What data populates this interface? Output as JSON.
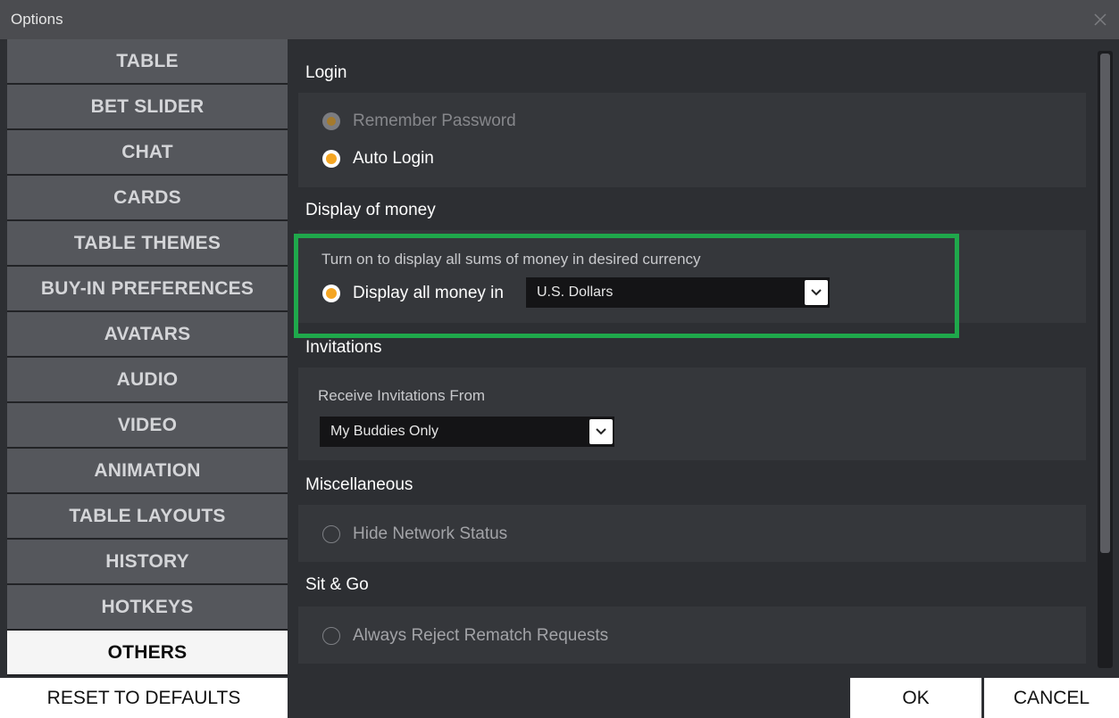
{
  "window": {
    "title": "Options",
    "close_icon": "close-icon"
  },
  "sidebar": {
    "items": [
      {
        "label": "TABLE"
      },
      {
        "label": "BET SLIDER"
      },
      {
        "label": "CHAT"
      },
      {
        "label": "CARDS"
      },
      {
        "label": "TABLE THEMES"
      },
      {
        "label": "BUY-IN PREFERENCES"
      },
      {
        "label": "AVATARS"
      },
      {
        "label": "AUDIO"
      },
      {
        "label": "VIDEO"
      },
      {
        "label": "ANIMATION"
      },
      {
        "label": "TABLE LAYOUTS"
      },
      {
        "label": "HISTORY"
      },
      {
        "label": "HOTKEYS"
      },
      {
        "label": "OTHERS",
        "active": true
      }
    ],
    "reset_label": "RESET TO DEFAULTS"
  },
  "login": {
    "title": "Login",
    "remember_password": "Remember Password",
    "auto_login": "Auto Login"
  },
  "display_money": {
    "title": "Display of money",
    "hint": "Turn on to display all sums of money in desired currency",
    "option_label": "Display all money in",
    "currency_value": "U.S. Dollars"
  },
  "invitations": {
    "title": "Invitations",
    "hint": "Receive Invitations From",
    "selected": "My Buddies Only"
  },
  "misc": {
    "title": "Miscellaneous",
    "hide_network_status": "Hide Network Status"
  },
  "sitgo": {
    "title": "Sit & Go",
    "reject_rematch": "Always Reject Rematch Requests"
  },
  "footer": {
    "ok_label": "OK",
    "cancel_label": "CANCEL"
  },
  "colors": {
    "accent": "#f5a623",
    "highlight": "#1fa84b"
  }
}
